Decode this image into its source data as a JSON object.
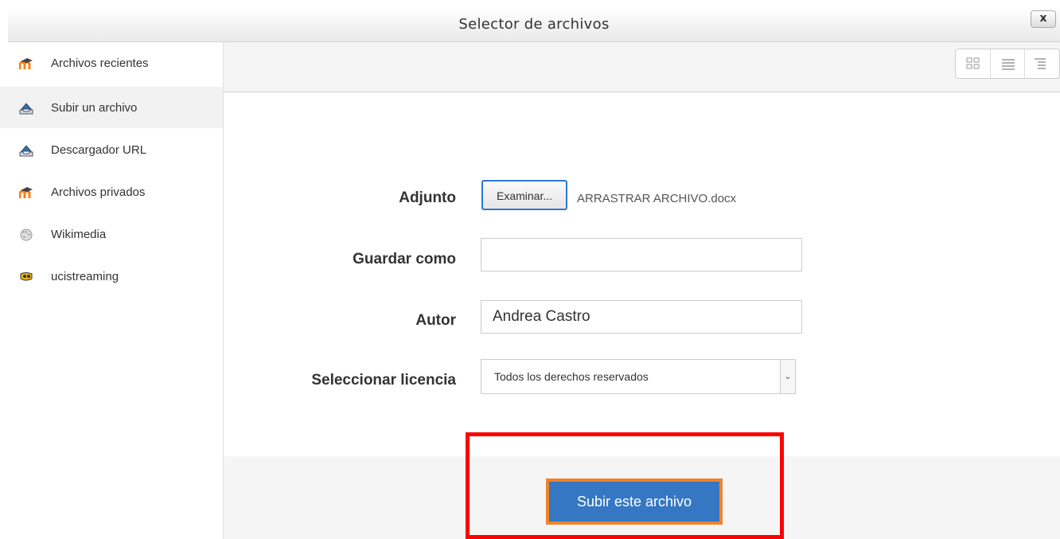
{
  "dialog": {
    "title": "Selector de archivos",
    "close_label": "x"
  },
  "sidebar": {
    "items": [
      {
        "label": "Archivos recientes",
        "icon": "moodle-icon",
        "active": false
      },
      {
        "label": "Subir un archivo",
        "icon": "upload-icon",
        "active": true
      },
      {
        "label": "Descargador URL",
        "icon": "upload-icon",
        "active": false
      },
      {
        "label": "Archivos privados",
        "icon": "moodle-icon",
        "active": false
      },
      {
        "label": "Wikimedia",
        "icon": "wikimedia-icon",
        "active": false
      },
      {
        "label": "ucistreaming",
        "icon": "ucistreaming-icon",
        "active": false
      }
    ]
  },
  "toolbar": {
    "view_buttons": [
      "grid-view-icon",
      "list-view-icon",
      "tree-view-icon"
    ]
  },
  "form": {
    "attachment": {
      "label": "Adjunto",
      "browse_label": "Examinar...",
      "file_name": "ARRASTRAR ARCHIVO.docx"
    },
    "save_as": {
      "label": "Guardar como",
      "value": ""
    },
    "author": {
      "label": "Autor",
      "value": "Andrea Castro"
    },
    "license": {
      "label": "Seleccionar licencia",
      "selected": "Todos los derechos reservados"
    },
    "submit_label": "Subir este archivo"
  },
  "colors": {
    "primary_button": "#3577c2",
    "highlight_border": "#ff0000",
    "button_outline": "#f0832b"
  }
}
